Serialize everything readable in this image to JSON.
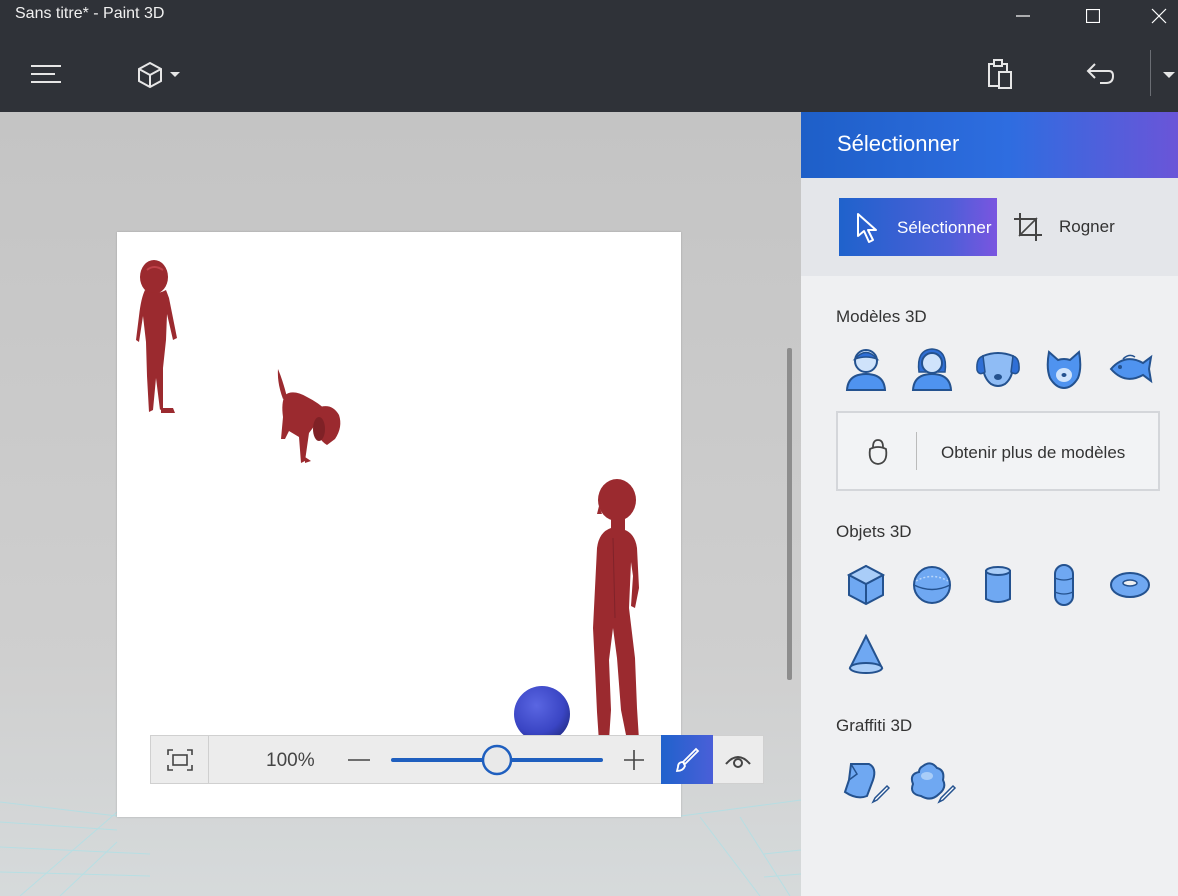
{
  "window": {
    "title": "Sans titre* - Paint 3D"
  },
  "toolbar": {
    "menu_icon": "hamburger-menu-icon",
    "tools_icon": "cube-icon",
    "paste_icon": "paste-icon",
    "undo_icon": "undo-icon"
  },
  "zoom": {
    "value": "100%",
    "slider_fraction": 0.5
  },
  "panel": {
    "title": "Sélectionner",
    "tools": [
      {
        "label": "Sélectionner",
        "icon": "cursor-icon",
        "active": true
      },
      {
        "label": "Rogner",
        "icon": "crop-icon",
        "active": false
      }
    ],
    "models_section": "Modèles 3D",
    "models": [
      "man-model-icon",
      "woman-model-icon",
      "dog-model-icon",
      "cat-model-icon",
      "fish-model-icon"
    ],
    "more_models_label": "Obtenir plus de modèles",
    "objects_section": "Objets 3D",
    "objects": [
      "cube-icon",
      "sphere-icon",
      "cylinder-icon",
      "capsule-icon",
      "torus-icon",
      "cone-icon"
    ],
    "graffiti_section": "Graffiti 3D",
    "graffiti": [
      "sharp-doodle-icon",
      "soft-doodle-icon"
    ]
  },
  "colors": {
    "titlebar": "#2f3238",
    "accent": "#1e5fc8",
    "model_red": "#9b2a2f",
    "ball_blue": "#3a45c4"
  }
}
